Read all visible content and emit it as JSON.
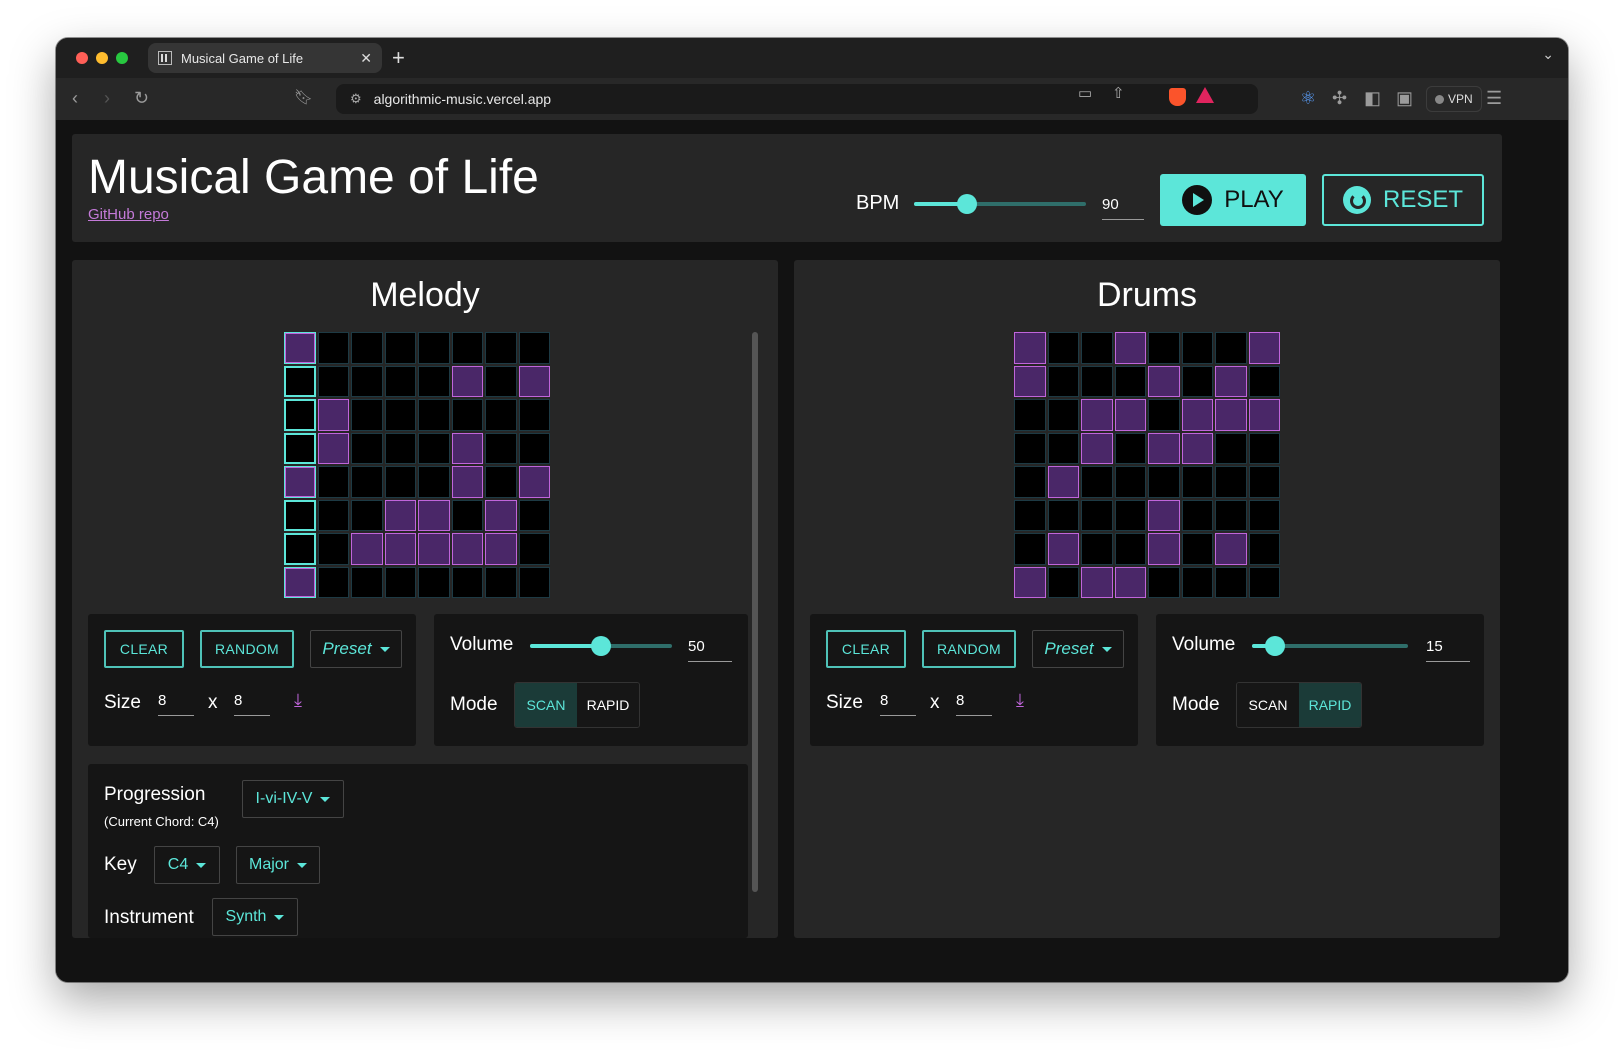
{
  "browser": {
    "tab_title": "Musical Game of Life",
    "url": "algorithmic-music.vercel.app",
    "vpn_label": "VPN"
  },
  "header": {
    "title": "Musical Game of Life",
    "repo_link": "GitHub repo",
    "bpm_label": "BPM",
    "bpm_value": "90",
    "bpm_fraction": 0.31,
    "play_label": "PLAY",
    "reset_label": "RESET"
  },
  "colors": {
    "accent": "#5ce6d9",
    "cell_on": "#4a2768",
    "cell_on_border": "#c065db"
  },
  "melody": {
    "title": "Melody",
    "grid": [
      [
        1,
        0,
        0,
        0,
        0,
        0,
        0,
        0
      ],
      [
        0,
        0,
        0,
        0,
        0,
        1,
        0,
        1
      ],
      [
        0,
        1,
        0,
        0,
        0,
        0,
        0,
        0
      ],
      [
        0,
        1,
        0,
        0,
        0,
        1,
        0,
        0
      ],
      [
        1,
        0,
        0,
        0,
        0,
        1,
        0,
        1
      ],
      [
        0,
        0,
        0,
        1,
        1,
        0,
        1,
        0
      ],
      [
        0,
        0,
        1,
        1,
        1,
        1,
        1,
        0
      ],
      [
        1,
        0,
        0,
        0,
        0,
        0,
        0,
        0
      ]
    ],
    "scan_column": 0,
    "clear_label": "CLEAR",
    "random_label": "RANDOM",
    "preset_label": "Preset",
    "size_label": "Size",
    "size_x": "8",
    "size_sep": "x",
    "size_y": "8",
    "volume_label": "Volume",
    "volume_value": "50",
    "volume_fraction": 0.5,
    "mode_label": "Mode",
    "mode_options": [
      "SCAN",
      "RAPID"
    ],
    "mode_selected": "SCAN",
    "progression_label": "Progression",
    "current_chord": "(Current Chord: C4)",
    "progression_value": "I-vi-IV-V",
    "key_label": "Key",
    "key_value": "C4",
    "scale_value": "Major",
    "instrument_label": "Instrument",
    "instrument_value": "Synth"
  },
  "drums": {
    "title": "Drums",
    "grid": [
      [
        1,
        0,
        0,
        1,
        0,
        0,
        0,
        1
      ],
      [
        1,
        0,
        0,
        0,
        1,
        0,
        1,
        0
      ],
      [
        0,
        0,
        1,
        1,
        0,
        1,
        1,
        1
      ],
      [
        0,
        0,
        1,
        0,
        1,
        1,
        0,
        0
      ],
      [
        0,
        1,
        0,
        0,
        0,
        0,
        0,
        0
      ],
      [
        0,
        0,
        0,
        0,
        1,
        0,
        0,
        0
      ],
      [
        0,
        1,
        0,
        0,
        1,
        0,
        1,
        0
      ],
      [
        1,
        0,
        1,
        1,
        0,
        0,
        0,
        0
      ]
    ],
    "clear_label": "CLEAR",
    "random_label": "RANDOM",
    "preset_label": "Preset",
    "size_label": "Size",
    "size_x": "8",
    "size_sep": "x",
    "size_y": "8",
    "volume_label": "Volume",
    "volume_value": "15",
    "volume_fraction": 0.15,
    "mode_label": "Mode",
    "mode_options": [
      "SCAN",
      "RAPID"
    ],
    "mode_selected": "RAPID"
  }
}
